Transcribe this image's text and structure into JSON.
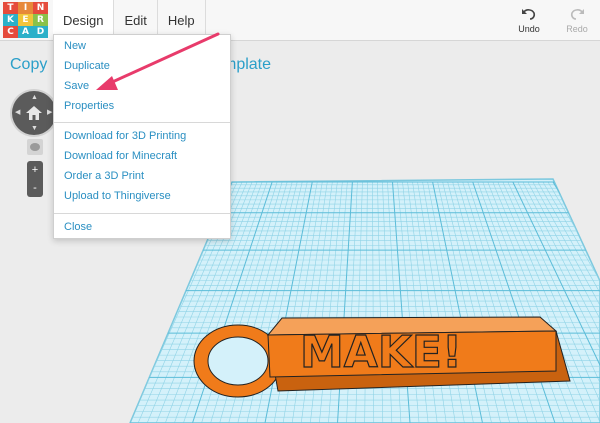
{
  "logo": {
    "letters": [
      "T",
      "I",
      "N",
      "K",
      "E",
      "R",
      "C",
      "A",
      "D"
    ],
    "colors": [
      "#e54b3c",
      "#e7893a",
      "#e54b3c",
      "#2bb0c9",
      "#f0c53a",
      "#8ac24a",
      "#e54b3c",
      "#2bb0c9",
      "#2bb0c9"
    ]
  },
  "menu": [
    {
      "label": "Design",
      "active": true
    },
    {
      "label": "Edit",
      "active": false
    },
    {
      "label": "Help",
      "active": false
    }
  ],
  "toolbar": {
    "undo_label": "Undo",
    "redo_label": "Redo"
  },
  "design": {
    "title_left": "Copy",
    "title_right": "mplate"
  },
  "zoom": {
    "plus": "+",
    "minus": "-"
  },
  "dropdown": {
    "group1": [
      "New",
      "Duplicate",
      "Save",
      "Properties"
    ],
    "group2": [
      "Download for 3D Printing",
      "Download for Minecraft",
      "Order a 3D Print",
      "Upload to Thingiverse"
    ],
    "group3": [
      "Close"
    ]
  },
  "model": {
    "text": "MAKE!",
    "color": "#f07b1a"
  },
  "colors": {
    "accent": "#2b9fc9",
    "grid_line": "#8fd3e6",
    "grid_bg": "#d4f1fa",
    "annotation_arrow": "#e83b6b"
  }
}
